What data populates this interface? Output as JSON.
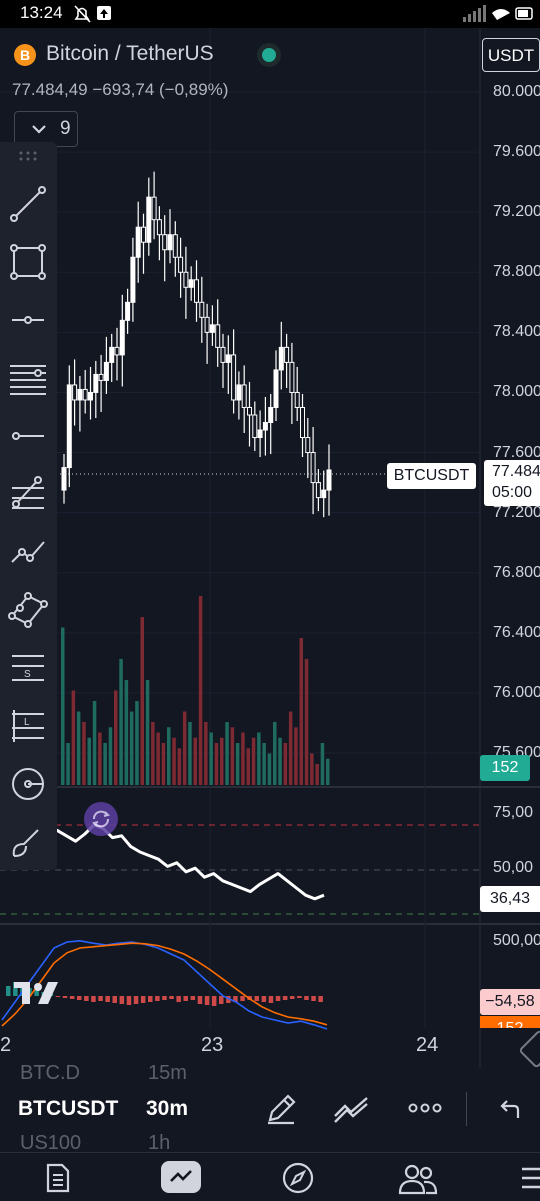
{
  "status": {
    "time": "13:24"
  },
  "header": {
    "coin_logo": "B",
    "symbol": "Bitcoin / TetherUS",
    "currency": "USDT",
    "price_line": "77.484,49 −693,74 (−0,89%)",
    "indicators_count": "9"
  },
  "price_axis": {
    "labels": [
      "80.000",
      "79.600",
      "79.200",
      "78.800",
      "78.400",
      "78.000",
      "77.600",
      "77.200",
      "76.800",
      "76.400",
      "76.000",
      "75.600"
    ],
    "current_tag": "BTCUSDT",
    "current_price": "77.484",
    "countdown": "05:00",
    "volume_tag": "152"
  },
  "rsi": {
    "labels": [
      "75,00",
      "50,00"
    ],
    "current": "36,43"
  },
  "macd": {
    "label": "500,00",
    "tag1": "−54,58",
    "tag2": "152"
  },
  "time_axis": {
    "labels": [
      "2",
      "23",
      "24"
    ]
  },
  "bottom": {
    "ghost_symbols": [
      "BTC.D",
      "US100"
    ],
    "ghost_intervals": [
      "15m",
      "1h"
    ],
    "symbol": "BTCUSDT",
    "interval": "30m"
  },
  "colors": {
    "up": "#22ab94",
    "down": "#f23645",
    "volume_up": "#1f6b60",
    "volume_down": "#7d2a32",
    "background": "#131722",
    "accent": "#2962ff"
  },
  "icons": [
    "bitcoin-icon",
    "chevron-down-icon",
    "trend-line-icon",
    "rectangle-icon",
    "horizontal-ray-icon",
    "pitchfork-icon",
    "horizontal-line-icon",
    "fib-retracement-icon",
    "polyline-icon",
    "pattern-icon",
    "long-position-icon",
    "short-position-icon",
    "cycle-icon",
    "brush-icon",
    "refresh-icon",
    "pencil-icon",
    "drawings-icon",
    "more-icon",
    "undo-icon",
    "watchlist-icon",
    "chart-icon",
    "explore-icon",
    "community-icon",
    "menu-icon"
  ]
}
